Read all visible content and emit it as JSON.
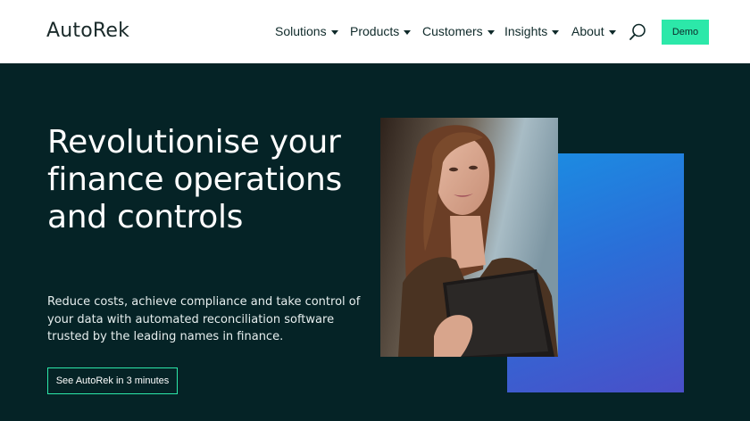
{
  "header": {
    "logo": "AutoRek",
    "nav": [
      {
        "label": "Solutions"
      },
      {
        "label": "Products"
      },
      {
        "label": "Customers"
      },
      {
        "label": "Insights"
      },
      {
        "label": "About"
      }
    ],
    "demo_label": "Demo",
    "search_icon": "search-icon"
  },
  "hero": {
    "headline": "Revolutionise your finance operations and controls",
    "subtext": "Reduce costs, achieve compliance and take control of your data with automated reconciliation software trusted by the leading names in finance.",
    "cta_label": "See AutoRek in 3 minutes",
    "photo_subject": "woman-holding-tablet"
  },
  "colors": {
    "hero_bg": "#052326",
    "accent": "#2ce8a9",
    "panel_gradient_start": "#1a8fe3",
    "panel_gradient_end": "#4a4fc8"
  }
}
